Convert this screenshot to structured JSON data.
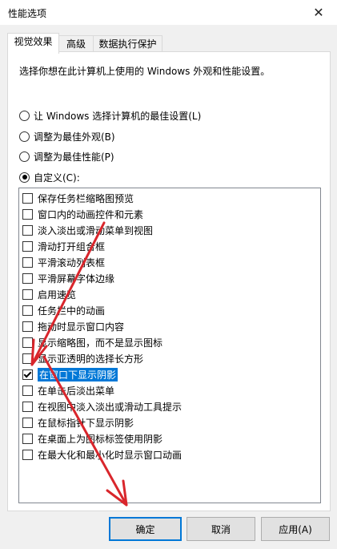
{
  "window": {
    "title": "性能选项",
    "close_glyph": "✕"
  },
  "tabs": [
    {
      "label": "视觉效果",
      "active": true
    },
    {
      "label": "高级",
      "active": false
    },
    {
      "label": "数据执行保护",
      "active": false
    }
  ],
  "description": "选择你想在此计算机上使用的 Windows 外观和性能设置。",
  "radios": [
    {
      "label": "让 Windows 选择计算机的最佳设置(L)",
      "selected": false
    },
    {
      "label": "调整为最佳外观(B)",
      "selected": false
    },
    {
      "label": "调整为最佳性能(P)",
      "selected": false
    },
    {
      "label": "自定义(C):",
      "selected": true
    }
  ],
  "effects": [
    {
      "label": "保存任务栏缩略图预览",
      "checked": false
    },
    {
      "label": "窗口内的动画控件和元素",
      "checked": false
    },
    {
      "label": "淡入淡出或滑动菜单到视图",
      "checked": false
    },
    {
      "label": "滑动打开组合框",
      "checked": false
    },
    {
      "label": "平滑滚动列表框",
      "checked": false
    },
    {
      "label": "平滑屏幕字体边缘",
      "checked": false
    },
    {
      "label": "启用速览",
      "checked": false
    },
    {
      "label": "任务栏中的动画",
      "checked": false
    },
    {
      "label": "拖动时显示窗口内容",
      "checked": false
    },
    {
      "label": "显示缩略图，而不是显示图标",
      "checked": false
    },
    {
      "label": "显示亚透明的选择长方形",
      "checked": false
    },
    {
      "label": "在窗口下显示阴影",
      "checked": true,
      "highlighted": true
    },
    {
      "label": "在单击后淡出菜单",
      "checked": false
    },
    {
      "label": "在视图中淡入淡出或滑动工具提示",
      "checked": false
    },
    {
      "label": "在鼠标指针下显示阴影",
      "checked": false
    },
    {
      "label": "在桌面上为图标标签使用阴影",
      "checked": false
    },
    {
      "label": "在最大化和最小化时显示窗口动画",
      "checked": false
    }
  ],
  "buttons": {
    "ok": "确定",
    "cancel": "取消",
    "apply": "应用(A)"
  },
  "colors": {
    "highlight": "#0078d7",
    "annotation_arrow": "#d9262c",
    "dialog_bg": "#f0f0f0"
  }
}
